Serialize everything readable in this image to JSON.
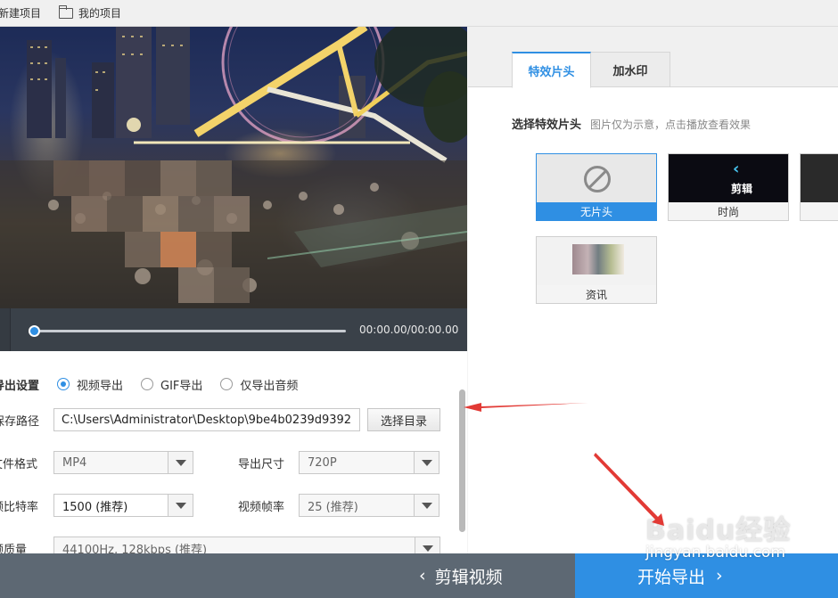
{
  "toolbar": {
    "new_project": "新建项目",
    "my_projects": "我的项目"
  },
  "player": {
    "timecode": "00:00.00/00:00.00",
    "progress": 0
  },
  "export_settings": {
    "section_label": "导出设置",
    "mode_options": [
      {
        "label": "视频导出",
        "selected": true
      },
      {
        "label": "GIF导出",
        "selected": false
      },
      {
        "label": "仅导出音频",
        "selected": false
      }
    ],
    "save_path_label": "保存路径",
    "save_path_value": "C:\\Users\\Administrator\\Desktop\\9be4b0239d9392",
    "browse_button": "选择目录",
    "format_label": "文件格式",
    "format_value": "MP4",
    "size_label": "导出尺寸",
    "size_value": "720P",
    "bitrate_label": "视频比特率",
    "bitrate_value": "1500 (推荐)",
    "framerate_label": "视频帧率",
    "framerate_value": "25 (推荐)",
    "audio_label": "音频质量",
    "audio_value": "44100Hz, 128kbps (推荐)"
  },
  "right_panel": {
    "tabs": [
      "特效片头",
      "加水印"
    ],
    "active_tab": "特效片头",
    "hint_title": "选择特效片头",
    "hint_text": "图片仅为示意，点击播放查看效果",
    "intros": [
      {
        "caption": "无片头",
        "selected": true
      },
      {
        "caption": "时尚",
        "selected": false
      },
      {
        "caption": "",
        "selected": false
      },
      {
        "caption": "资讯",
        "selected": false
      }
    ],
    "intro2_text": "剪辑"
  },
  "bottom": {
    "back_label": "剪辑视频",
    "export_label": "开始导出"
  },
  "watermark": {
    "line1": "Baidu经验",
    "line2": "jingyan.baidu.com"
  },
  "colors": {
    "accent": "#2f8fe3",
    "annotation_arrow": "#e23a35"
  }
}
